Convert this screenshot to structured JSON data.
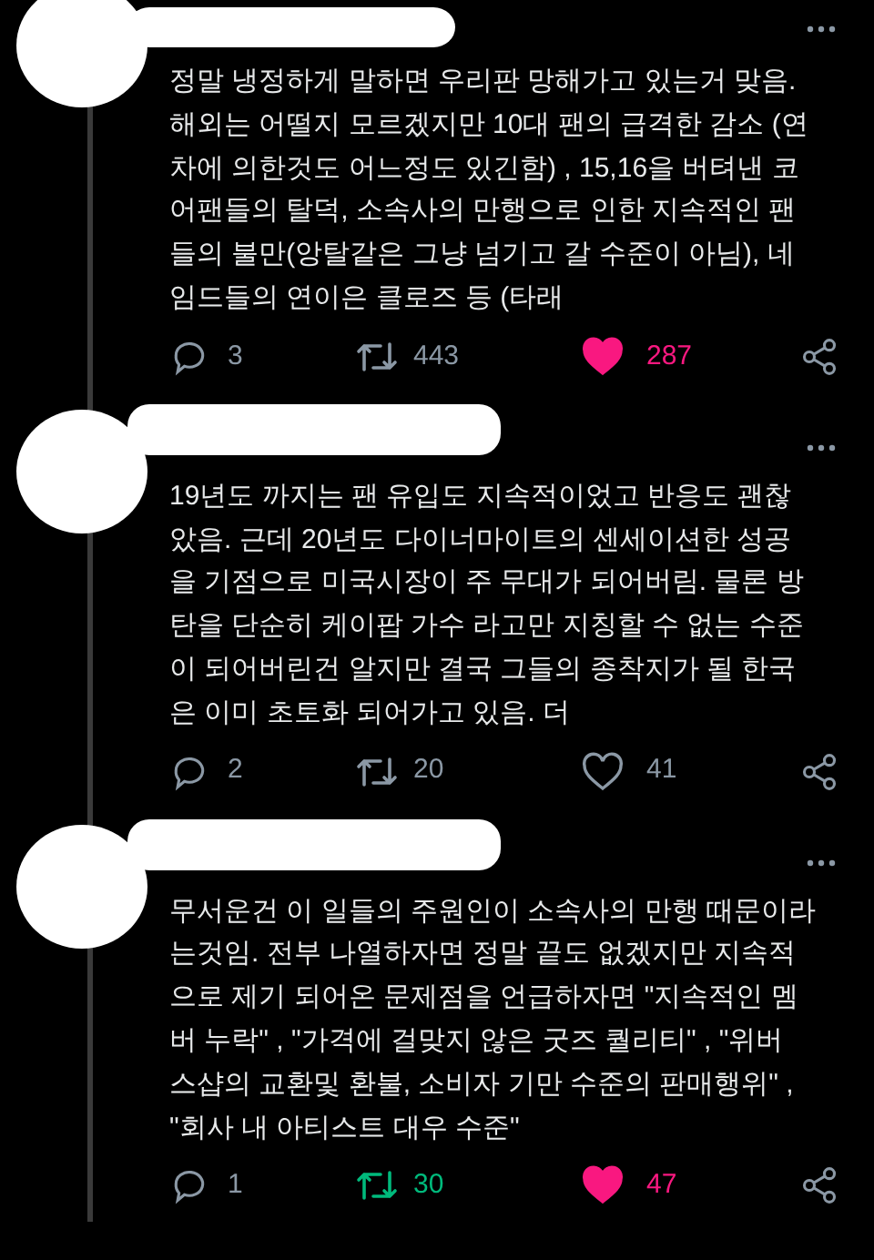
{
  "tweets": [
    {
      "text": "정말 냉정하게 말하면 우리판 망해가고 있는거 맞음.\n해외는 어떨지 모르겠지만 10대 팬의 급격한 감소 (연\n차에 의한것도 어느정도 있긴함) , 15,16을 버텨낸 코\n어팬들의 탈덕, 소속사의 만행으로 인한 지속적인 팬\n들의 불만(앙탈같은 그냥 넘기고 갈 수준이 아님), 네\n임드들의 연이은 클로즈 등 (타래",
      "replies": "3",
      "retweets": "443",
      "likes": "287",
      "retweeted": false,
      "liked": true
    },
    {
      "text": "19년도 까지는 팬 유입도 지속적이었고 반응도 괜찮\n았음. 근데 20년도 다이너마이트의 센세이션한 성공\n을 기점으로 미국시장이 주 무대가 되어버림. 물론 방\n탄을 단순히 케이팝 가수 라고만 지칭할 수 없는 수준\n이 되어버린건 알지만 결국 그들의 종착지가 될 한국\n은 이미 초토화 되어가고 있음. 더",
      "replies": "2",
      "retweets": "20",
      "likes": "41",
      "retweeted": false,
      "liked": false
    },
    {
      "text": "무서운건 이 일들의 주원인이 소속사의 만행 때문이라\n는것임. 전부 나열하자면 정말 끝도 없겠지만 지속적\n으로 제기 되어온 문제점을 언급하자면 \"지속적인 멤\n버 누락\" , \"가격에 걸맞지 않은 굿즈 퀄리티\" , \"위버\n스샵의 교환및 환불, 소비자 기만 수준의 판매행위\" ,\n\"회사 내 아티스트 대우 수준\"",
      "replies": "1",
      "retweets": "30",
      "likes": "47",
      "retweeted": true,
      "liked": true
    }
  ]
}
